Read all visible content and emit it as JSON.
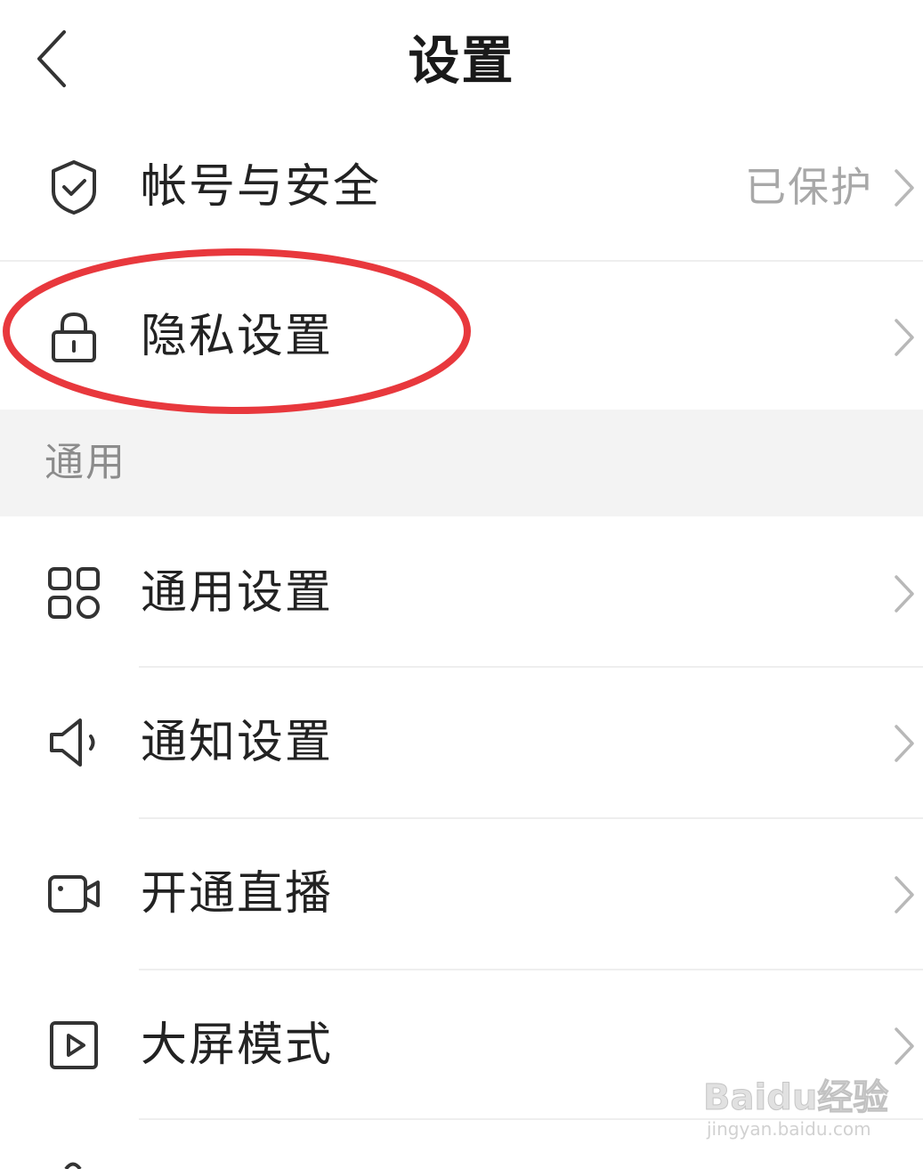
{
  "header": {
    "title": "设置",
    "back_icon": "chevron-left-icon"
  },
  "account_rows": [
    {
      "icon": "shield-check-icon",
      "label": "帐号与安全",
      "value": "已保护"
    },
    {
      "icon": "lock-icon",
      "label": "隐私设置",
      "value": ""
    }
  ],
  "general_section": {
    "title": "通用",
    "rows": [
      {
        "icon": "grid-apps-icon",
        "label": "通用设置"
      },
      {
        "icon": "speaker-icon",
        "label": "通知设置"
      },
      {
        "icon": "video-camera-icon",
        "label": "开通直播"
      },
      {
        "icon": "play-square-icon",
        "label": "大屏模式"
      }
    ]
  },
  "watermark": {
    "logo": "Baidu经验",
    "url": "jingyan.baidu.com"
  },
  "colors": {
    "annotation_circle": "#e8383d",
    "section_bg": "#f3f3f3",
    "divider": "#eeeeee",
    "secondary_text": "#a8a8a8"
  }
}
